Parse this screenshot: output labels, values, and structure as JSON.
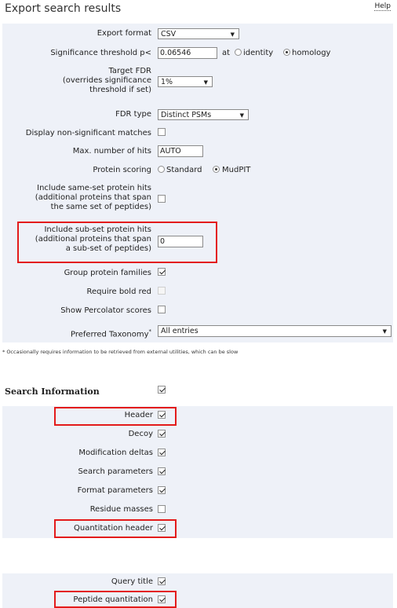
{
  "page": {
    "title": "Export search results",
    "help": "Help"
  },
  "export": {
    "export_format": {
      "label": "Export format",
      "value": "CSV"
    },
    "significance": {
      "label": "Significance threshold p<",
      "value": "0.06546",
      "at": "at",
      "opt1": "identity",
      "opt2": "homology",
      "selected": "homology"
    },
    "target_fdr": {
      "line1": "Target FDR",
      "line2": "(overrides significance",
      "line3": "threshold if set)",
      "value": "1%"
    },
    "fdr_type": {
      "label": "FDR type",
      "value": "Distinct PSMs"
    },
    "non_sig": {
      "label": "Display non-significant matches",
      "checked": false
    },
    "max_hits": {
      "label": "Max. number of hits",
      "value": "AUTO"
    },
    "protein_scoring": {
      "label": "Protein scoring",
      "opt1": "Standard",
      "opt2": "MudPIT",
      "selected": "MudPIT"
    },
    "same_set": {
      "line1": "Include same-set protein hits",
      "line2": "(additional proteins that span",
      "line3": "the same set of peptides)",
      "checked": false
    },
    "sub_set": {
      "line1": "Include sub-set protein hits",
      "line2": "(additional proteins that span",
      "line3": "a sub-set of peptides)",
      "value": "0"
    },
    "group_families": {
      "label": "Group protein families",
      "checked": true
    },
    "bold_red": {
      "label": "Require bold red",
      "checked": false,
      "disabled": true
    },
    "percolator": {
      "label": "Show Percolator scores",
      "checked": false
    },
    "taxonomy": {
      "label": "Preferred Taxonomy",
      "star": "*",
      "value": "All entries"
    }
  },
  "footnote": "* Occasionally requires information to be retrieved from external utilities, which can be slow",
  "search_info": {
    "heading": "Search Information",
    "checked": true,
    "items": [
      {
        "label": "Header",
        "checked": true
      },
      {
        "label": "Decoy",
        "checked": true
      },
      {
        "label": "Modification deltas",
        "checked": true
      },
      {
        "label": "Search parameters",
        "checked": true
      },
      {
        "label": "Format parameters",
        "checked": true
      },
      {
        "label": "Residue masses",
        "checked": false
      },
      {
        "label": "Quantitation header",
        "checked": true
      }
    ]
  },
  "query_info": {
    "items": [
      {
        "label": "Query title",
        "checked": true
      },
      {
        "label": "Peptide quantitation",
        "checked": true
      }
    ]
  },
  "colors": {
    "panel_bg": "#eef1f8",
    "highlight": "#e31b1b"
  }
}
